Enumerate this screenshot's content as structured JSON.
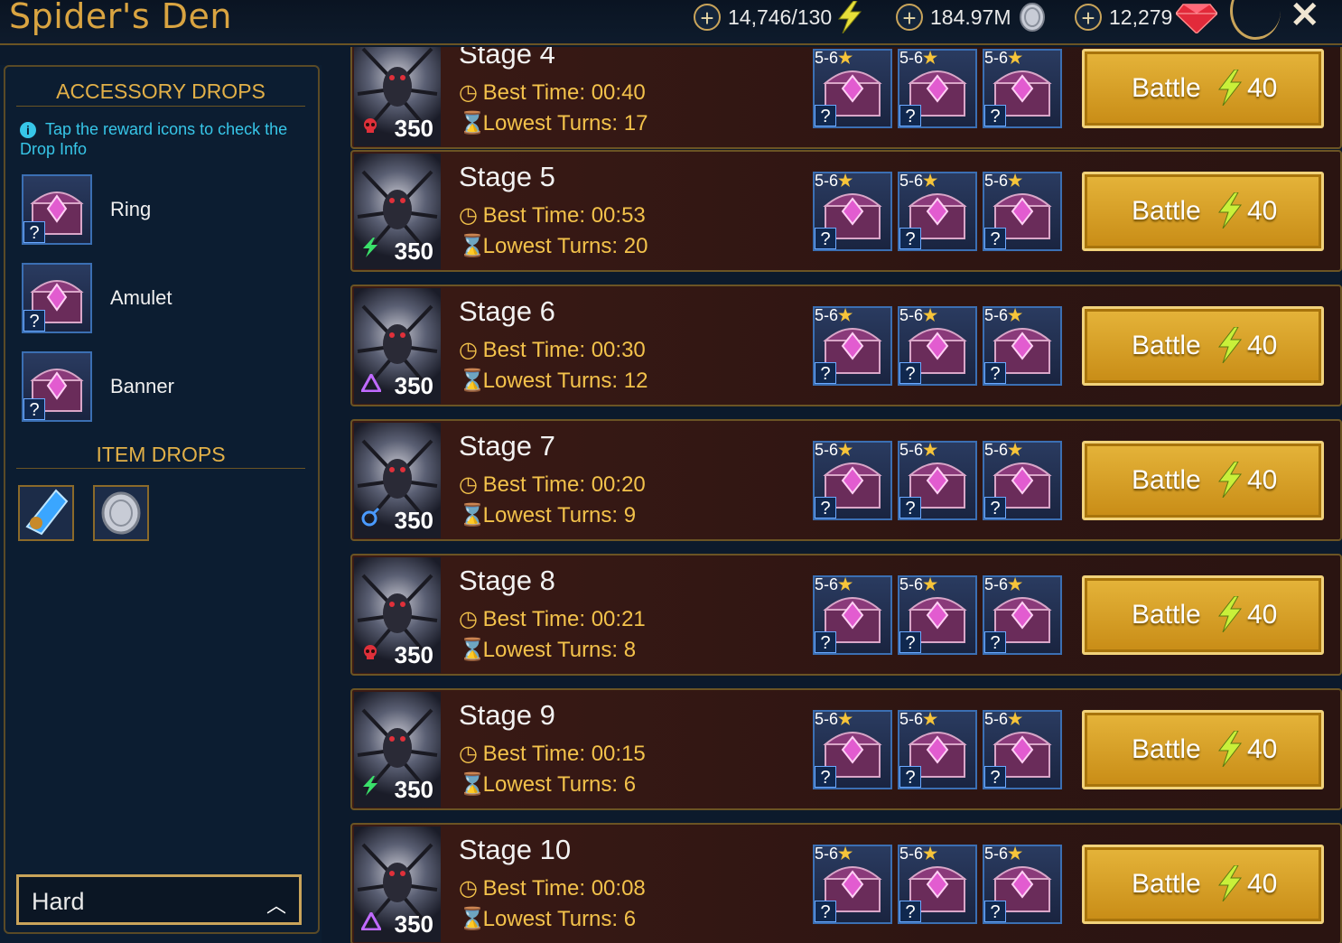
{
  "header": {
    "title": "Spider's Den",
    "energy": "14,746/130",
    "silver": "184.97M",
    "gems": "12,279"
  },
  "left": {
    "accessory_title": "ACCESSORY DROPS",
    "info_text": "Tap the reward icons to check the Drop Info",
    "accessories": [
      {
        "label": "Ring",
        "q": "?"
      },
      {
        "label": "Amulet",
        "q": "?"
      },
      {
        "label": "Banner",
        "q": "?"
      }
    ],
    "item_title": "ITEM DROPS",
    "difficulty": "Hard"
  },
  "stages": [
    {
      "name": "Stage 4",
      "best_label": "Best Time: 00:40",
      "turns_label": "Lowest Turns: 17",
      "power": "350",
      "affinity": "skull",
      "rarity": "5-6",
      "battle": "Battle",
      "cost": "40"
    },
    {
      "name": "Stage 5",
      "best_label": "Best Time: 00:53",
      "turns_label": "Lowest Turns: 20",
      "power": "350",
      "affinity": "bolt",
      "rarity": "5-6",
      "battle": "Battle",
      "cost": "40"
    },
    {
      "name": "Stage 6",
      "best_label": "Best Time: 00:30",
      "turns_label": "Lowest Turns: 12",
      "power": "350",
      "affinity": "triangle",
      "rarity": "5-6",
      "battle": "Battle",
      "cost": "40"
    },
    {
      "name": "Stage 7",
      "best_label": "Best Time: 00:20",
      "turns_label": "Lowest Turns: 9",
      "power": "350",
      "affinity": "drop",
      "rarity": "5-6",
      "battle": "Battle",
      "cost": "40"
    },
    {
      "name": "Stage 8",
      "best_label": "Best Time: 00:21",
      "turns_label": "Lowest Turns: 8",
      "power": "350",
      "affinity": "skull",
      "rarity": "5-6",
      "battle": "Battle",
      "cost": "40"
    },
    {
      "name": "Stage 9",
      "best_label": "Best Time: 00:15",
      "turns_label": "Lowest Turns: 6",
      "power": "350",
      "affinity": "bolt",
      "rarity": "5-6",
      "battle": "Battle",
      "cost": "40"
    },
    {
      "name": "Stage 10",
      "best_label": "Best Time: 00:08",
      "turns_label": "Lowest Turns: 6",
      "power": "350",
      "affinity": "triangle",
      "rarity": "5-6",
      "battle": "Battle",
      "cost": "40"
    }
  ],
  "colors": {
    "gold": "#d9a441",
    "battle": "#e5b43a",
    "info": "#37c6e8"
  }
}
